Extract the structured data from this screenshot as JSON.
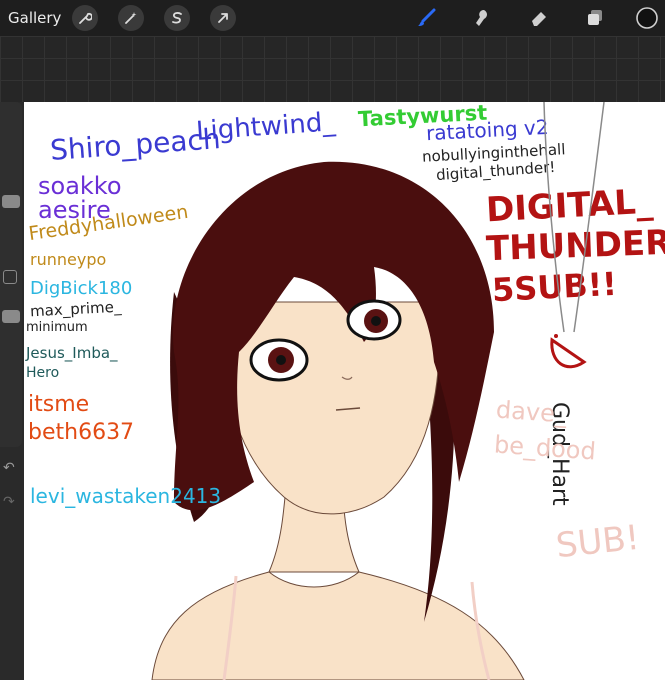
{
  "toolbar": {
    "gallery_label": "Gallery",
    "left_tools": [
      "wrench-icon",
      "magic-wand-icon",
      "selection-icon",
      "transform-arrow-icon"
    ],
    "right_tools": [
      "brush-icon",
      "smudge-icon",
      "eraser-icon",
      "layers-icon",
      "color-swatch-icon"
    ],
    "active_tool": "brush-icon",
    "accent_color": "#2a6af6",
    "current_color": "#111111"
  },
  "canvas": {
    "names": [
      {
        "text": "Shiro_peach",
        "color": "#3a3ad1"
      },
      {
        "text": "Lightwind_",
        "color": "#3a3ad1"
      },
      {
        "text": "Tastywurst",
        "color": "#33cc33"
      },
      {
        "text": "ratatoing v2",
        "color": "#3a3ad1"
      },
      {
        "text": "nobullyinginthehall",
        "color": "#222222"
      },
      {
        "text": "digital_thunder!",
        "color": "#222222"
      },
      {
        "text": "soakko",
        "color": "#6a2fd6"
      },
      {
        "text": "aesire",
        "color": "#6a2fd6"
      },
      {
        "text": "Freddyhalloween",
        "color": "#c08a1a"
      },
      {
        "text": "runneypo",
        "color": "#c08a1a"
      },
      {
        "text": "DigBick180",
        "color": "#2bb6e0"
      },
      {
        "text": "max_prime_",
        "color": "#222222"
      },
      {
        "text": "minimum",
        "color": "#222222"
      },
      {
        "text": "Jesus_Imba_",
        "color": "#1f5a5a"
      },
      {
        "text": "Hero",
        "color": "#1f5a5a"
      },
      {
        "text": "itsme",
        "color": "#e24b14"
      },
      {
        "text": "beth6637",
        "color": "#e24b14"
      },
      {
        "text": "levi_wastaken2413",
        "color": "#2bb6e0"
      },
      {
        "text": "DIGITAL_",
        "color": "#b31313"
      },
      {
        "text": "THUNDER",
        "color": "#b31313"
      },
      {
        "text": "5SUB!!",
        "color": "#b31313"
      },
      {
        "text": "Gud_Hart",
        "color": "#222222"
      },
      {
        "text": "dave_",
        "color": "#f0c8c0"
      },
      {
        "text": "be_dood",
        "color": "#f0c8c0"
      },
      {
        "text": "SUB!",
        "color": "#f0c8c0"
      }
    ]
  }
}
